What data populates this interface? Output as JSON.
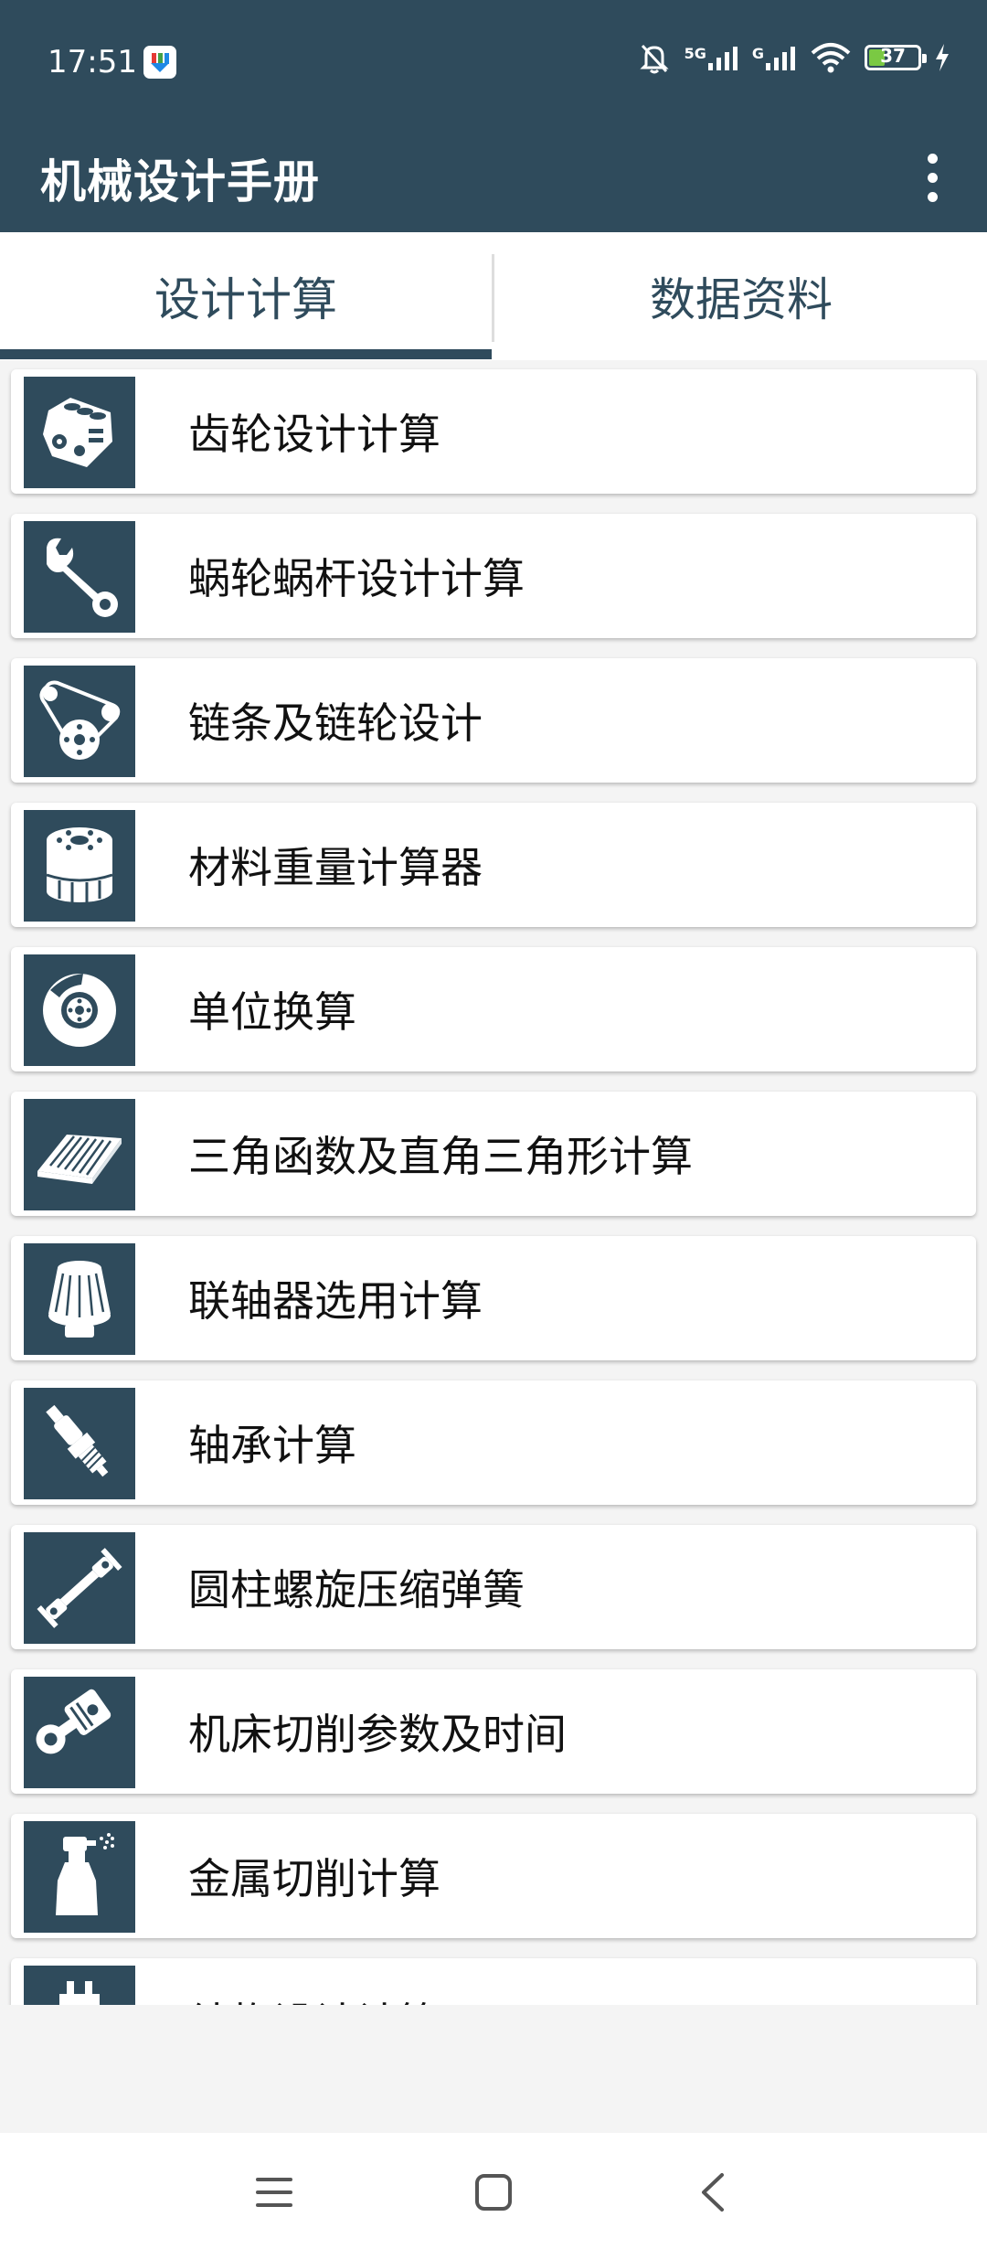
{
  "status": {
    "time": "17:51",
    "signal1_label": "5G",
    "signal2_label": "G",
    "battery_level": "37"
  },
  "app": {
    "title": "机械设计手册"
  },
  "tabs": [
    {
      "label": "设计计算",
      "selected": true
    },
    {
      "label": "数据资料",
      "selected": false
    }
  ],
  "items": [
    {
      "label": "齿轮设计计算",
      "icon": "engine-icon"
    },
    {
      "label": "蜗轮蜗杆设计计算",
      "icon": "wrench-icon"
    },
    {
      "label": "链条及链轮设计",
      "icon": "belt-pulley-icon"
    },
    {
      "label": "材料重量计算器",
      "icon": "oil-filter-icon"
    },
    {
      "label": "单位换算",
      "icon": "brake-disc-icon"
    },
    {
      "label": "三角函数及直角三角形计算",
      "icon": "air-filter-icon"
    },
    {
      "label": "联轴器选用计算",
      "icon": "cone-filter-icon"
    },
    {
      "label": "轴承计算",
      "icon": "spark-plug-icon"
    },
    {
      "label": "圆柱螺旋压缩弹簧",
      "icon": "drive-shaft-icon"
    },
    {
      "label": "机床切削参数及时间",
      "icon": "piston-icon"
    },
    {
      "label": "金属切削计算",
      "icon": "spray-bottle-icon"
    },
    {
      "label": "结构设计计算",
      "icon": "fuse-icon"
    }
  ],
  "colors": {
    "primary": "#2f4b5c",
    "background": "#f4f4f4",
    "battery": "#7ac943"
  }
}
